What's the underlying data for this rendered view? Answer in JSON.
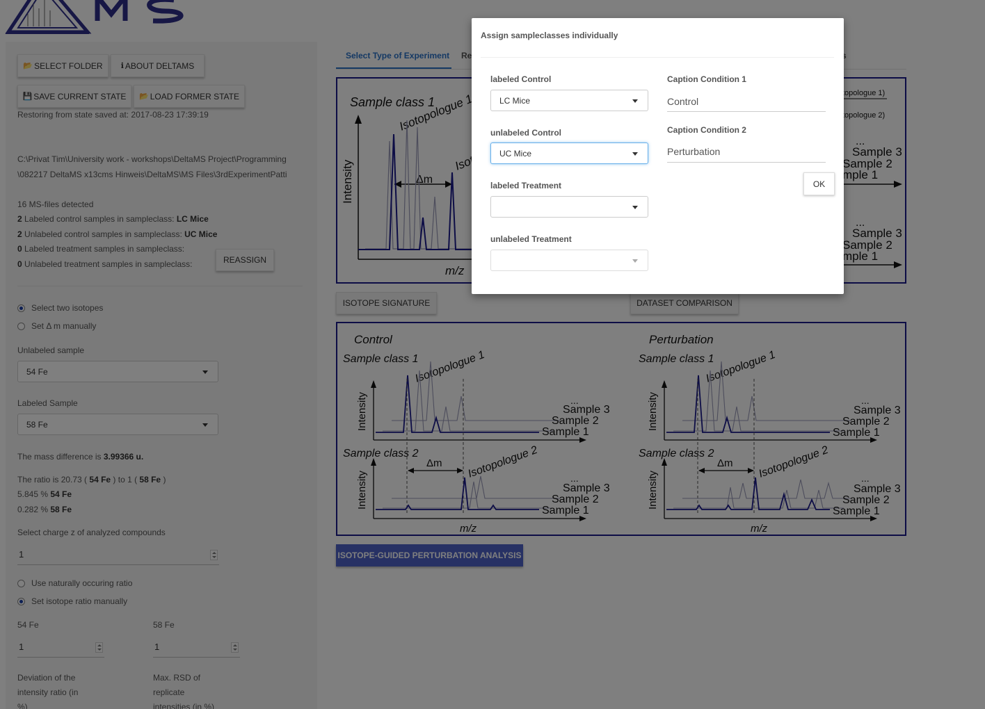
{
  "sidebar": {
    "select_folder": "SELECT FOLDER",
    "about": "ABOUT DELTAMS",
    "save_state": "SAVE CURRENT STATE",
    "load_state": "LOAD FORMER STATE",
    "restore_text": "Restoring from state saved at: 2017-08-23 17:39:19",
    "path_line1": "C:\\Privat Tim\\University work - workshops\\DeltaMS Project\\Programming",
    "path_line2": "\\082217 DeltaMS x13cms Hinweis\\DeltaMS\\MS Files\\3rdExperimentPatti",
    "files_detected": "16 MS-files detected",
    "lc_count": "2",
    "lc_text": " Labeled control samples in sampleclass: ",
    "lc_class": "LC Mice",
    "uc_count": "2",
    "uc_text": " Unlabeled control samples in sampleclass: ",
    "uc_class": "UC Mice",
    "lt_count": "0",
    "lt_text": " Labeled treatment samples in sampleclass:",
    "ut_count": "0",
    "ut_text": " Unlabeled treatment samples in sampleclass:",
    "reassign": "REASSIGN",
    "radio_two_isotopes": "Select two isotopes",
    "radio_dm_manual": "Set Δ m manually",
    "unlabeled_sample_label": "Unlabeled sample",
    "unlabeled_sample_value": "54 Fe",
    "labeled_sample_label": "Labeled Sample",
    "labeled_sample_value": "58 Fe",
    "mass_diff_text": "The mass difference is ",
    "mass_diff_value": "3.99366 u.",
    "ratio_text_a": "The ratio is 20.73 ( ",
    "ratio_iso1": "54 Fe",
    "ratio_text_b": " ) to 1 ( ",
    "ratio_iso2": "58 Fe",
    "ratio_text_c": " )",
    "abund1_pct": "5.845 % ",
    "abund1_iso": "54 Fe",
    "abund2_pct": "0.282 % ",
    "abund2_iso": "58 Fe",
    "charge_label": "Select charge z of analyzed compounds",
    "charge_value": "1",
    "radio_natural": "Use naturally occuring ratio",
    "radio_manual_ratio": "Set isotope ratio manually",
    "iso1_label": "54 Fe",
    "iso1_value": "1",
    "iso2_label": "58 Fe",
    "iso2_value": "1",
    "deviation_label_1": "Deviation of the",
    "deviation_label_2": "intensity ratio (in",
    "deviation_label_3": "%)",
    "rsd_label_1": "Max. RSD of",
    "rsd_label_2": "replicate",
    "rsd_label_3": "intensities (in %)"
  },
  "main": {
    "tab_active": "Select Type of Experiment",
    "tab_partial": "Re",
    "tab_partial_right": "s",
    "isotope_signature": "ISOTOPE SIGNATURE",
    "dataset_comparison": "DATASET COMPARISON",
    "perturbation_analysis": "ISOTOPE-GUIDED PERTURBATION ANALYSIS"
  },
  "figure_top": {
    "sample_class": "Sample class 1",
    "isotopologue": "Isotopologue 1",
    "isotopologue_partial": "Isot",
    "intensity": "Intensity",
    "dm": "Δm",
    "mz": "m/z",
    "legend1": "topologue 1)",
    "legend2": "topologue 2)",
    "dots": "...",
    "s3": "Sample 3",
    "s2": "Sample 2",
    "s1": "mple 1",
    "s2b": "Sample 2",
    "s1b": "mple 1"
  },
  "figure_bottom": {
    "control": "Control",
    "perturbation": "Perturbation",
    "class1": "Sample class 1",
    "class2": "Sample class 2",
    "iso1": "Isotopologue 1",
    "iso2": "Isotopologue 2",
    "intensity": "Intensity",
    "dm": "Δm",
    "mz": "m/z",
    "dots": "...",
    "s3": "Sample 3",
    "s2": "Sample 2",
    "s1": "Sample 1"
  },
  "modal": {
    "title": "Assign sampleclasses individually",
    "labeled_control_label": "labeled Control",
    "labeled_control_value": "LC Mice",
    "unlabeled_control_label": "unlabeled Control",
    "unlabeled_control_value": "UC Mice",
    "labeled_treatment_label": "labeled Treatment",
    "labeled_treatment_value": "",
    "unlabeled_treatment_label": "unlabeled Treatment",
    "unlabeled_treatment_value": "",
    "caption1_label": "Caption Condition 1",
    "caption1_value": "Control",
    "caption2_label": "Caption Condition 2",
    "caption2_value": "Perturbation",
    "ok": "OK"
  },
  "colors": {
    "navy": "#1a1a8c",
    "accent_blue": "#2a73c9",
    "primary_button": "#4e63c9"
  }
}
